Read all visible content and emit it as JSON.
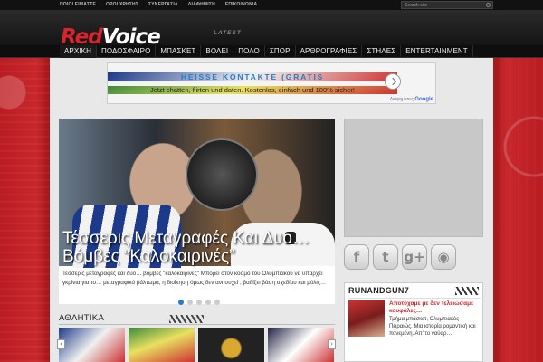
{
  "topbar": {
    "links": [
      "ΠΟΙΟΙ ΕΙΜΑΣΤΕ",
      "ΟΡΟΙ ΧΡΗΣΗΣ",
      "ΣΥΝΕΡΓΑΣΙΑ",
      "ΔΙΑΦΗΜΙΣΗ",
      "ΕΠΙΚΟΙΝΩΝΙΑ"
    ],
    "search_placeholder": "Search site"
  },
  "header": {
    "logo_red": "Red",
    "logo_white": "Voice",
    "latest_label": "LATEST"
  },
  "nav": {
    "items": [
      "ΑΡΧΙΚΗ",
      "ΠΟΔΟΣΦΑΙΡΟ",
      "ΜΠΑΣΚΕΤ",
      "ΒΟΛΕΙ",
      "ΠΟΛΟ",
      "ΣΠΟΡ",
      "ΑΡΘΡΟΓΡΑΦΙΕΣ",
      "ΣΤΗΛΕΣ",
      "ENTERTAINMENT"
    ]
  },
  "ad": {
    "headline": "HEISSE KONTAKTE (GRATIS",
    "body": "Jetzt chatten, flirten und daten. Kostenlos, einfach und 100% sicher!",
    "badge_prefix": "Διαφημίσεις",
    "badge_brand": "Google"
  },
  "slider": {
    "title": "Τέσσερις Μεταγραφές Και Δυο… Βόμβες “Καλοκαιρινές”",
    "excerpt": "Τέσσερις μεταγραφές και δυο… βόμβες \"καλοκαιρινές\" Μπορεί στον κόσμο του Ολυμπιακού να υπάρχει γκρίνια για το… μεταγραφικό βάλτωμα, η διοίκηση όμως δεν ανησυχεί , βαδίζει βάση σχεδίου και μόλις…",
    "dots": 5,
    "active_dot": 0
  },
  "social": {
    "buttons": [
      "f",
      "t",
      "g+",
      "rss"
    ]
  },
  "widget": {
    "title": "RUNANDGUN7",
    "post_title": "Αποτύχαμε με δεν τελειώσαμε κουφάλες…",
    "post_excerpt": "Τμήμα μπάσκετ, Ολυμπιακός Πειραιώς. Μια ιστορία ρομαντική και πονεμένη. Απ' το ναύαρ…"
  },
  "section": {
    "title": "ΑΘΛΗΤΙΚΑ"
  },
  "colors": {
    "brand_red": "#d8242a",
    "link_blue": "#2a7cc2",
    "nav_bg": "#0e0e0e"
  }
}
